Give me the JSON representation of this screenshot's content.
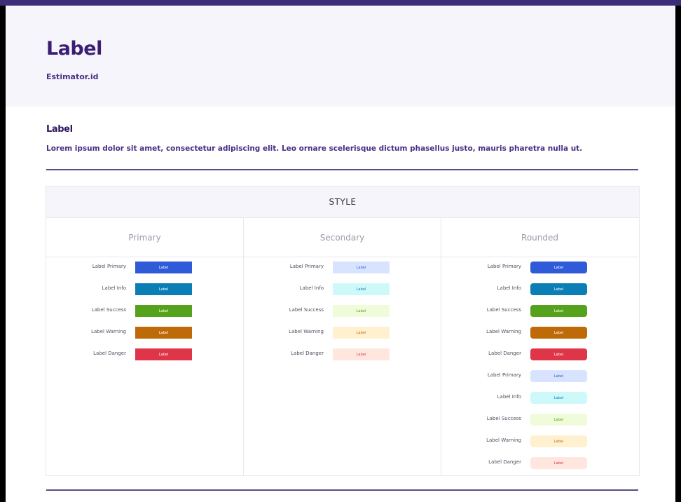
{
  "hero": {
    "title": "Label",
    "subtitle": "Estimator.id"
  },
  "section": {
    "title": "Label",
    "description": "Lorem ipsum dolor sit amet, consectetur adipiscing elit. Leo ornare scelerisque dictum phasellus justo, mauris pharetra nulla ut."
  },
  "table": {
    "header": "STYLE",
    "columns": [
      "Primary",
      "Secondary",
      "Rounded"
    ],
    "primary_rows": [
      {
        "label": "Label Primary",
        "badge": "Label"
      },
      {
        "label": "Label Info",
        "badge": "Label"
      },
      {
        "label": "Label Success",
        "badge": "Label"
      },
      {
        "label": "Label Warning",
        "badge": "Label"
      },
      {
        "label": "Label Danger",
        "badge": "Label"
      }
    ],
    "secondary_rows": [
      {
        "label": "Label Primary",
        "badge": "Label"
      },
      {
        "label": "Label Info",
        "badge": "Label"
      },
      {
        "label": "Label Success",
        "badge": "Label"
      },
      {
        "label": "Label Warning",
        "badge": "Label"
      },
      {
        "label": "Label Danger",
        "badge": "Label"
      }
    ],
    "rounded_rows": [
      {
        "label": "Label Primary",
        "badge": "Label"
      },
      {
        "label": "Label Info",
        "badge": "Label"
      },
      {
        "label": "Label Success",
        "badge": "Label"
      },
      {
        "label": "Label Warning",
        "badge": "Label"
      },
      {
        "label": "Label Danger",
        "badge": "Label"
      },
      {
        "label": "Label Primary",
        "badge": "Label"
      },
      {
        "label": "Label Info",
        "badge": "Label"
      },
      {
        "label": "Label Success",
        "badge": "Label"
      },
      {
        "label": "Label Warning",
        "badge": "Label"
      },
      {
        "label": "Label Danger",
        "badge": "Label"
      }
    ]
  },
  "colors": {
    "primary": "#2f5bd9",
    "info": "#0b7fb5",
    "success": "#55a31c",
    "warning": "#bf6a08",
    "danger": "#de3548"
  }
}
